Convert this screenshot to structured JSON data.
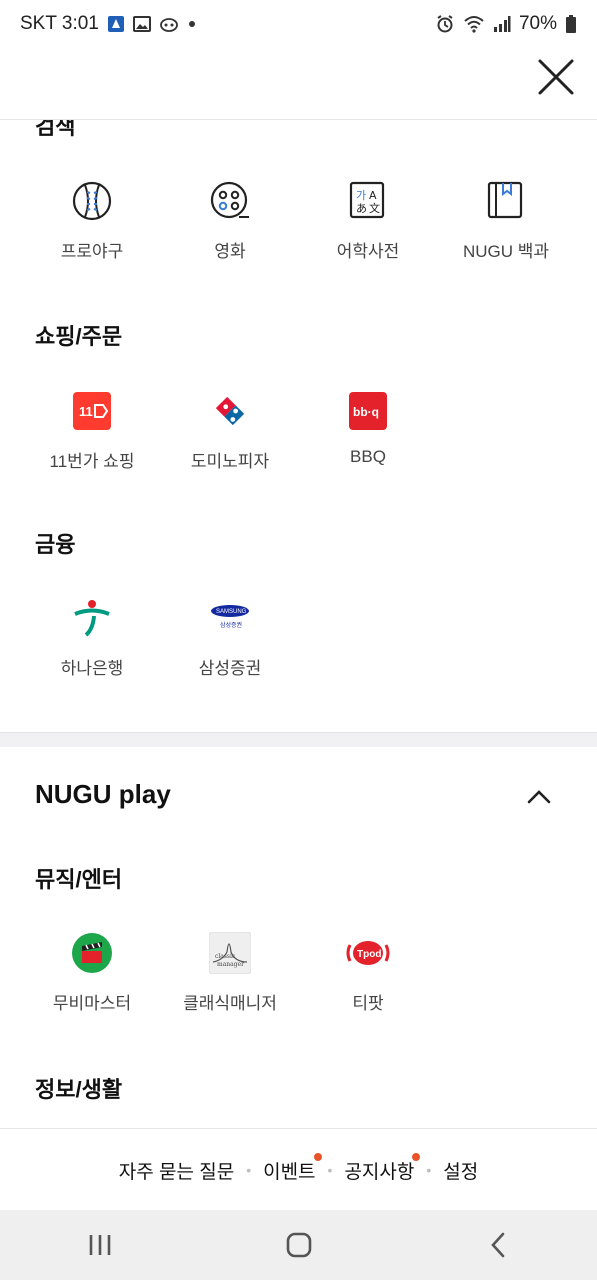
{
  "status_bar": {
    "carrier_time": "SKT 3:01",
    "battery": "70%"
  },
  "sections": {
    "search": {
      "title": "검색",
      "items": [
        {
          "label": "프로야구",
          "icon": "baseball-icon"
        },
        {
          "label": "영화",
          "icon": "film-reel-icon"
        },
        {
          "label": "어학사전",
          "icon": "dictionary-icon"
        },
        {
          "label": "NUGU 백과",
          "icon": "encyclopedia-icon"
        }
      ]
    },
    "shopping": {
      "title": "쇼핑/주문",
      "items": [
        {
          "label": "11번가 쇼핑",
          "icon": "11st-logo-icon"
        },
        {
          "label": "도미노피자",
          "icon": "dominos-logo-icon"
        },
        {
          "label": "BBQ",
          "icon": "bbq-logo-icon"
        }
      ]
    },
    "finance": {
      "title": "금융",
      "items": [
        {
          "label": "하나은행",
          "icon": "hana-bank-logo-icon"
        },
        {
          "label": "삼성증권",
          "icon": "samsung-securities-logo-icon"
        }
      ]
    }
  },
  "nugu_play": {
    "title": "NUGU play",
    "music": {
      "title": "뮤직/엔터",
      "items": [
        {
          "label": "무비마스터",
          "icon": "movie-master-icon"
        },
        {
          "label": "클래식매니저",
          "icon": "classic-manager-icon"
        },
        {
          "label": "티팟",
          "icon": "tpod-icon"
        }
      ]
    },
    "info_title": "정보/생활"
  },
  "footer": {
    "links": [
      "자주 묻는 질문",
      "이벤트",
      "공지사항",
      "설정"
    ]
  },
  "colors": {
    "accent_dot": "#e8532a",
    "divider": "#f1f1f3"
  }
}
